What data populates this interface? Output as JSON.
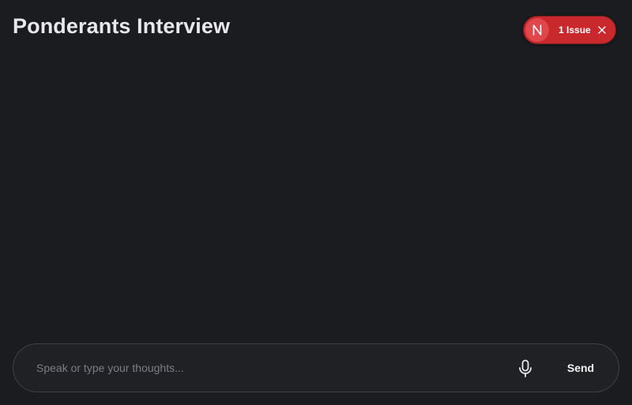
{
  "header": {
    "title": "Ponderants Interview"
  },
  "issues_badge": {
    "logo_letter": "N",
    "label": "1 Issue",
    "icons": [
      "nextjs-logo-icon",
      "close-icon"
    ],
    "color": "#c9282d"
  },
  "composer": {
    "input_value": "",
    "placeholder": "Speak or type your thoughts...",
    "mic_icon": "microphone-icon",
    "send_label": "Send"
  },
  "colors": {
    "background": "#1b1c1f",
    "composer_background": "#202124",
    "composer_border": "#3f4146",
    "title_text": "#e8e8ea",
    "placeholder_text": "#7b7e85"
  }
}
